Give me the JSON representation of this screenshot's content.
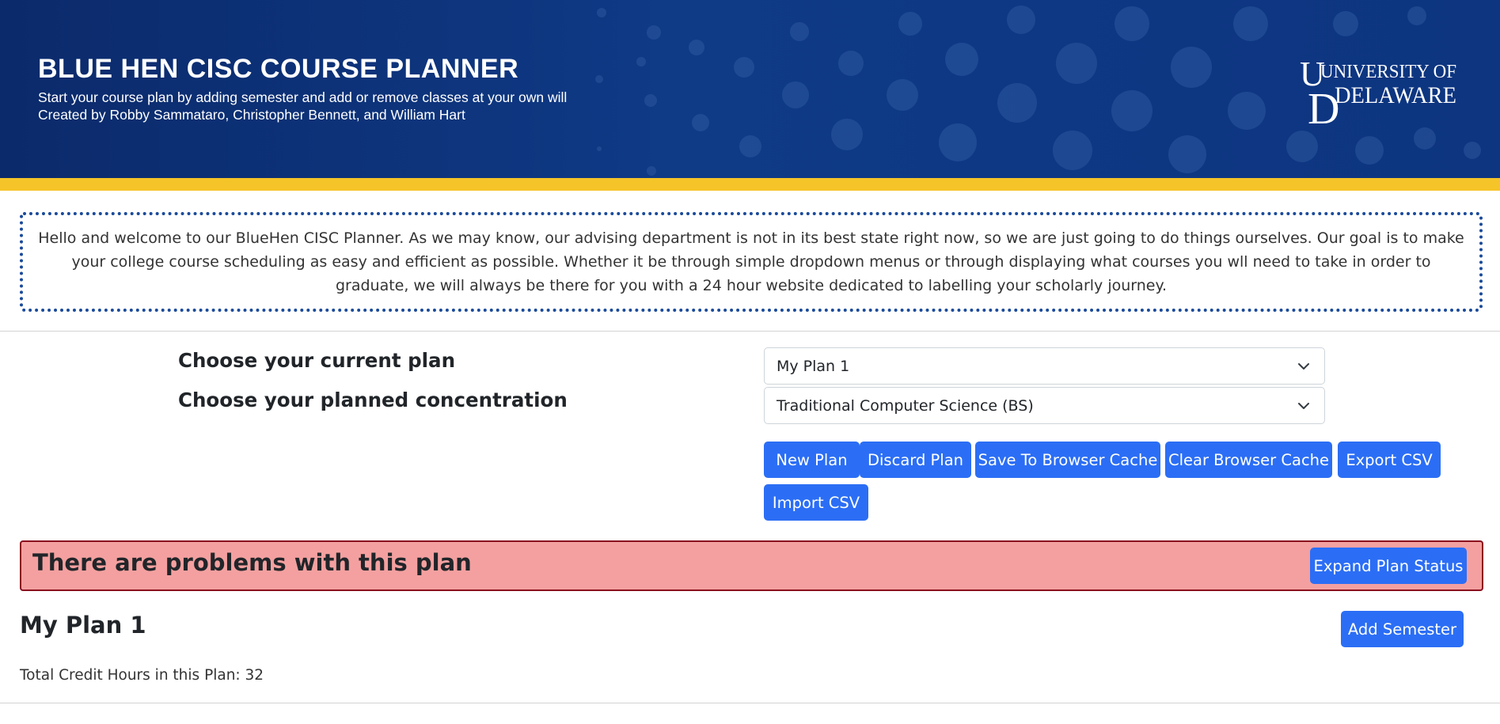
{
  "header": {
    "title": "BLUE HEN CISC COURSE PLANNER",
    "subtitle_1": "Start your course plan by adding  semester and add or remove classes at your own will",
    "subtitle_2": "Created by Robby Sammataro, Christopher Bennett, and William Hart",
    "logo_line_1": "UNIVERSITY OF",
    "logo_line_2": "DELAWARE",
    "logo_icon": "university-of-delaware-logo"
  },
  "intro": {
    "text": "Hello and welcome to our BlueHen CISC Planner. As we may know, our advising department is not in its best state right now, so we are just going to do things ourselves. Our goal is to make your college course scheduling as easy and efficient as possible. Whether it be through simple dropdown menus or through displaying what courses you wll need to take in order to graduate, we will always be there for you with a 24 hour website dedicated to labelling your scholarly journey."
  },
  "controls": {
    "plan_label": "Choose your current plan",
    "concentration_label": "Choose your planned concentration",
    "plan_select_value": "My Plan 1",
    "concentration_select_value": "Traditional Computer Science (BS)",
    "buttons": {
      "new_plan": "New Plan",
      "discard_plan": "Discard Plan",
      "save_cache": "Save To Browser Cache",
      "clear_cache": "Clear Browser Cache",
      "export_csv": "Export CSV",
      "import_csv": "Import CSV"
    }
  },
  "alert": {
    "message": "There are problems with this plan",
    "expand_button": "Expand Plan Status"
  },
  "plan": {
    "title": "My Plan 1",
    "add_semester_button": "Add Semester",
    "credits_text": "Total Credit Hours in this Plan: 32"
  },
  "colors": {
    "banner_blue": "#0f3a86",
    "stripe_gold": "#f5c428",
    "button_blue": "#2b6ef5",
    "alert_bg": "#f4a0a0",
    "alert_border": "#8a0f1e"
  }
}
